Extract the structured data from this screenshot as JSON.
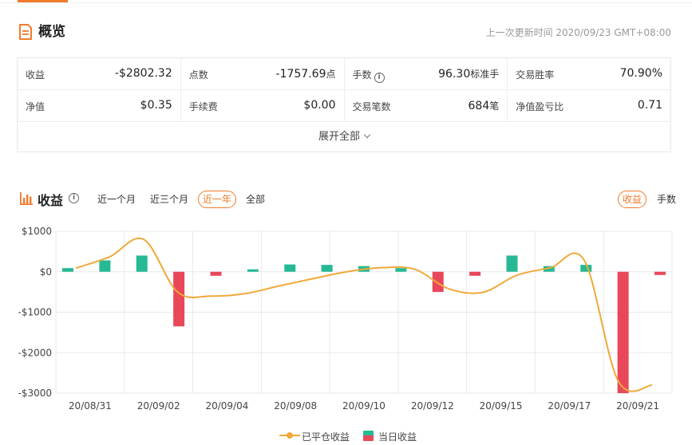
{
  "overview": {
    "title": "概览",
    "update_time": "上一次更新时间 2020/09/23 GMT+08:00",
    "rows": [
      [
        {
          "label": "收益",
          "value": "-$2802.32",
          "unit": ""
        },
        {
          "label": "点数",
          "value": "-1757.69",
          "unit": "点"
        },
        {
          "label": "手数",
          "value": "96.30",
          "unit": "标准手",
          "info": true
        },
        {
          "label": "交易胜率",
          "value": "70.90%",
          "unit": ""
        }
      ],
      [
        {
          "label": "净值",
          "value": "$0.35",
          "unit": ""
        },
        {
          "label": "手续费",
          "value": "$0.00",
          "unit": ""
        },
        {
          "label": "交易笔数",
          "value": "684",
          "unit": "笔"
        },
        {
          "label": "净值盈亏比",
          "value": "0.71",
          "unit": ""
        }
      ]
    ],
    "expand_label": "展开全部"
  },
  "profit": {
    "title": "收益",
    "info_glyph": "i",
    "ranges": [
      {
        "label": "近一个月",
        "active": false
      },
      {
        "label": "近三个月",
        "active": false
      },
      {
        "label": "近一年",
        "active": true
      },
      {
        "label": "全部",
        "active": false
      }
    ],
    "modes": [
      {
        "label": "收益",
        "active": true
      },
      {
        "label": "手数",
        "active": false
      }
    ]
  },
  "chart_data": {
    "type": "bar",
    "y_ticks": [
      "$1000",
      "$0",
      "-$1000",
      "-$2000",
      "-$3000"
    ],
    "ylim": [
      -3000,
      1000
    ],
    "x_tick_labels": [
      "20/08/31",
      "20/09/02",
      "20/09/04",
      "20/09/08",
      "20/09/10",
      "20/09/12",
      "20/09/15",
      "20/09/17",
      "20/09/21"
    ],
    "grid": true,
    "legend_position": "bottom",
    "colors": {
      "positive": "#26b993",
      "negative": "#e8485a",
      "line": "#f0a93a",
      "grid": "#e9e9e9"
    },
    "series": [
      {
        "name": "当日收益",
        "type": "bar",
        "values": [
          90,
          280,
          400,
          -1350,
          -100,
          60,
          180,
          170,
          140,
          90,
          -500,
          -100,
          400,
          140,
          170,
          -3000,
          -80
        ]
      },
      {
        "name": "已平仓收益",
        "type": "line",
        "values": [
          90,
          370,
          800,
          -500,
          -600,
          -540,
          -350,
          -170,
          0,
          100,
          60,
          -420,
          -510,
          -90,
          100,
          280,
          -2700,
          -2800
        ]
      }
    ]
  }
}
